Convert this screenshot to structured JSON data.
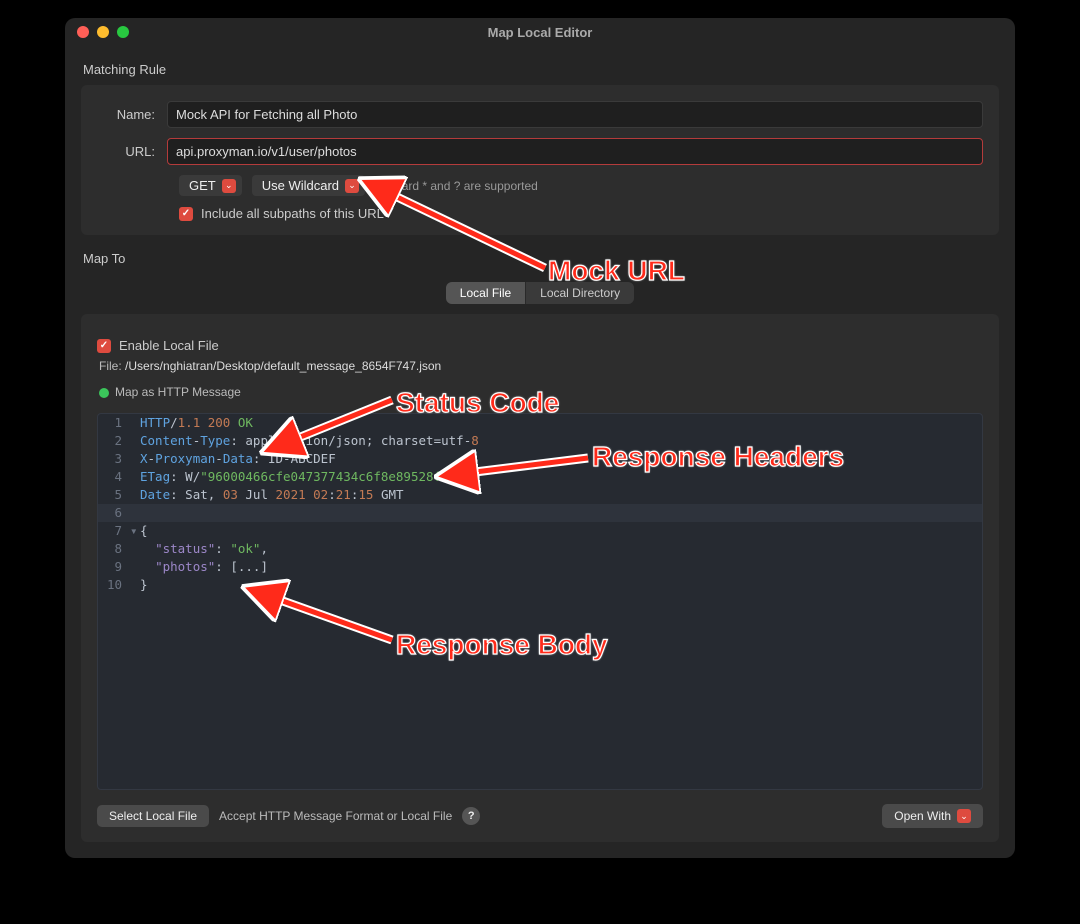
{
  "window": {
    "title": "Map Local Editor"
  },
  "matching": {
    "section_title": "Matching Rule",
    "name_label": "Name:",
    "name_value": "Mock API for Fetching all Photo",
    "url_label": "URL:",
    "url_value": "api.proxyman.io/v1/user/photos",
    "method": "GET",
    "mode": "Use Wildcard",
    "hint": "wildcard * and ? are supported",
    "include_label": "Include all subpaths of this URL"
  },
  "mapto": {
    "section_title": "Map To",
    "tab_local_file": "Local File",
    "tab_local_dir": "Local Directory",
    "enable_label": "Enable Local File",
    "file_prefix": "File: ",
    "file_path": "/Users/nghiatran/Desktop/default_message_8654F747.json",
    "map_as_label": "Map as HTTP Message"
  },
  "editor": {
    "lines": [
      {
        "n": "1",
        "raw": "HTTP/1.1 200 OK"
      },
      {
        "n": "2",
        "raw": "Content-Type: application/json; charset=utf-8"
      },
      {
        "n": "3",
        "raw": "X-Proxyman-Data: ID-ABCDEF"
      },
      {
        "n": "4",
        "raw": "ETag: W/\"96000466cfe047377434c6f8e89528fa\""
      },
      {
        "n": "5",
        "raw": "Date: Sat, 03 Jul 2021 02:21:15 GMT"
      },
      {
        "n": "6",
        "raw": ""
      },
      {
        "n": "7",
        "raw": "{",
        "fold": true
      },
      {
        "n": "8",
        "raw": "  \"status\": \"ok\","
      },
      {
        "n": "9",
        "raw": "  \"photos\": [...]"
      },
      {
        "n": "10",
        "raw": "}"
      }
    ]
  },
  "bottom": {
    "select_file": "Select Local File",
    "accept_text": "Accept HTTP Message Format or Local File",
    "open_with": "Open With"
  },
  "annotations": {
    "mock_url": "Mock URL",
    "status_code": "Status Code",
    "response_headers": "Response Headers",
    "response_body": "Response Body"
  }
}
